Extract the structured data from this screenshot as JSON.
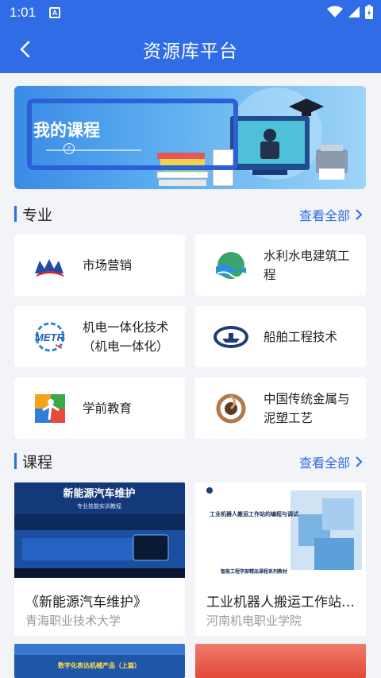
{
  "status_bar": {
    "time": "1:01",
    "notification": "A"
  },
  "header": {
    "title": "资源库平台"
  },
  "banner": {
    "title": "我的课程"
  },
  "majors": {
    "title": "专业",
    "view_all": "查看全部",
    "items": [
      {
        "label": "市场营销",
        "icon": "marketing-logo-icon"
      },
      {
        "label": "水利水电建筑工程",
        "icon": "hydraulic-logo-icon"
      },
      {
        "label": "机电一体化技术（机电一体化）",
        "icon": "metr-logo-icon"
      },
      {
        "label": "船舶工程技术",
        "icon": "ship-logo-icon"
      },
      {
        "label": "学前教育",
        "icon": "preschool-logo-icon"
      },
      {
        "label": "中国传统金属与泥塑工艺",
        "icon": "craft-logo-icon"
      }
    ]
  },
  "courses": {
    "title": "课程",
    "view_all": "查看全部",
    "items": [
      {
        "title": "《新能源汽车维护》",
        "school": "青海职业技术大学",
        "thumb_title": "新能源汽车维护",
        "thumb_subtitle": "专业技能实训教程"
      },
      {
        "title": "工业机器人搬运工作站的编程与调试",
        "school": "河南机电职业学院",
        "thumb_title": "工业机器人搬运工作站的编程与调试",
        "thumb_subtitle": "智能工程学部精品课程系列教材"
      }
    ],
    "partial": [
      {
        "thumb_title": "数字化表达机械产品（上篇）"
      }
    ]
  },
  "colors": {
    "primary": "#2f6ce5",
    "background": "#f2f4f7"
  }
}
